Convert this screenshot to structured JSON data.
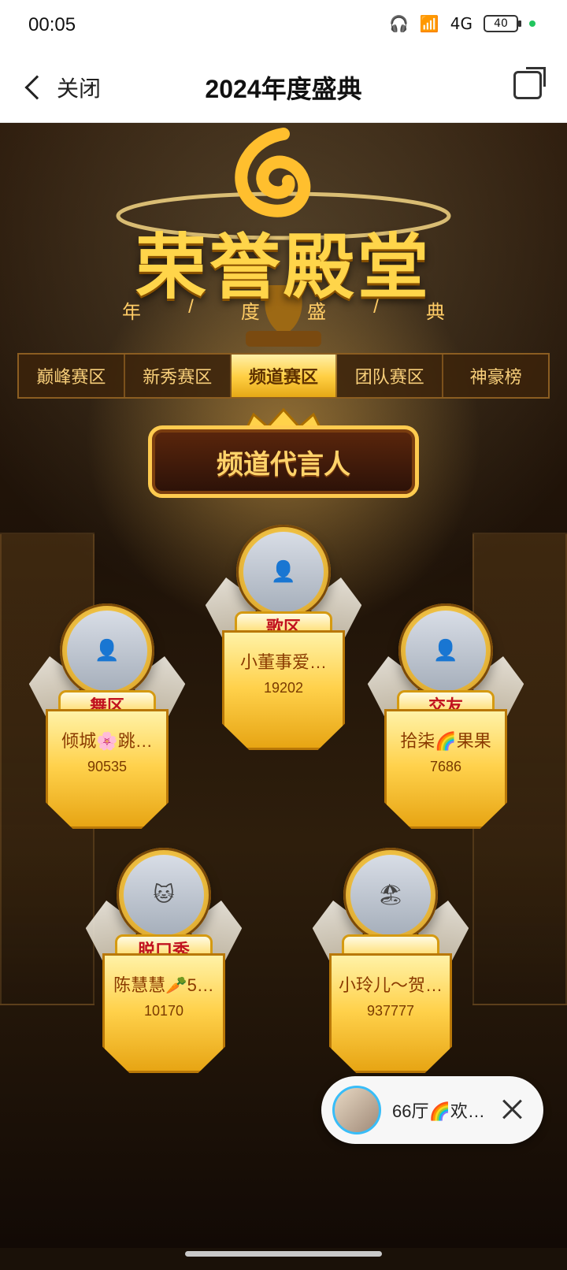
{
  "status": {
    "time": "00:05",
    "network": "4G",
    "battery": "40"
  },
  "nav": {
    "back_label": "关闭",
    "title": "2024年度盛典"
  },
  "hero": {
    "title": "荣誉殿堂",
    "subtitle": [
      "年",
      "/",
      "度",
      "盛",
      "/",
      "典"
    ]
  },
  "tabs": [
    {
      "label": "巅峰赛区",
      "active": false
    },
    {
      "label": "新秀赛区",
      "active": false
    },
    {
      "label": "频道赛区",
      "active": true
    },
    {
      "label": "团队赛区",
      "active": false
    },
    {
      "label": "神豪榜",
      "active": false
    }
  ],
  "section": {
    "title": "频道代言人"
  },
  "cards": [
    {
      "category": "歌区",
      "name": "小董事爱…",
      "score": "19202"
    },
    {
      "category": "舞区",
      "name": "倾城🌸跳…",
      "score": "90535"
    },
    {
      "category": "交友",
      "name": "拾柒🌈果果",
      "score": "7686"
    },
    {
      "category": "脱口秀",
      "name": "陈慧慧🥕5…",
      "score": "10170"
    },
    {
      "category": "",
      "name": "小玲儿～贺…",
      "score": "937777"
    }
  ],
  "floating": {
    "text": "66厅🌈欢…"
  }
}
